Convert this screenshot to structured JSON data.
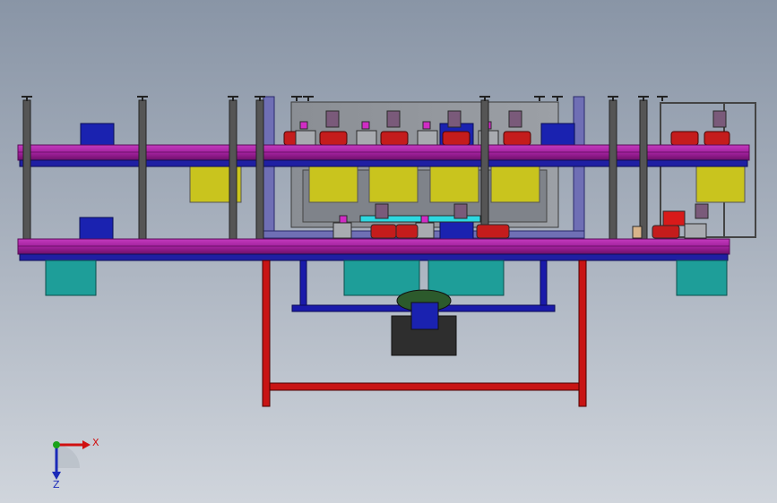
{
  "viewport": {
    "background_top": "#8995a6",
    "background_bottom": "#d0d5dc"
  },
  "colors": {
    "conveyor_magenta": "#a3219e",
    "conveyor_edge": "#5a0c57",
    "rail_navy": "#1f1fa3",
    "post_gray": "#555555",
    "yellow_box": "#c9c41e",
    "teal_box": "#1e9e99",
    "red_frame": "#c81414",
    "blue_frame": "#1a1aaa",
    "motor_red": "#c41c1c",
    "dark_block": "#2e2e2e",
    "panel_gray": "#8a8e94"
  },
  "icons": {
    "axis_triad": "xyz-axis-triad-icon"
  },
  "axis_triad": {
    "x_label": "X",
    "z_label": "Z",
    "x_color": "#d01010",
    "z_color": "#1a2ab8",
    "y_color": "#1aa21a"
  }
}
